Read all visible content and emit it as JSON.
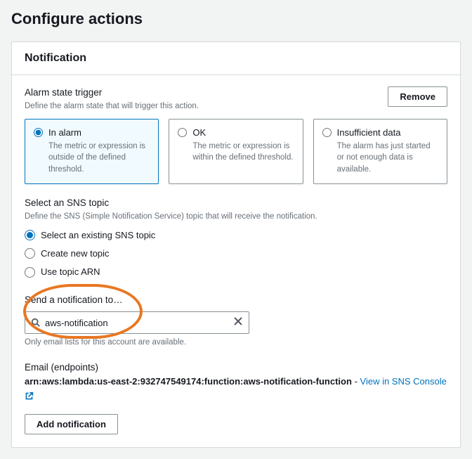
{
  "page": {
    "title": "Configure actions"
  },
  "panel": {
    "title": "Notification"
  },
  "alarm_trigger": {
    "label": "Alarm state trigger",
    "help": "Define the alarm state that will trigger this action.",
    "remove_btn": "Remove",
    "options": [
      {
        "title": "In alarm",
        "desc": "The metric or expression is outside of the defined threshold."
      },
      {
        "title": "OK",
        "desc": "The metric or expression is within the defined threshold."
      },
      {
        "title": "Insufficient data",
        "desc": "The alarm has just started or not enough data is available."
      }
    ]
  },
  "sns": {
    "label": "Select an SNS topic",
    "help": "Define the SNS (Simple Notification Service) topic that will receive the notification.",
    "options": {
      "existing": "Select an existing SNS topic",
      "create": "Create new topic",
      "arn": "Use topic ARN"
    }
  },
  "send_to": {
    "label": "Send a notification to…",
    "value": "aws-notification",
    "hint": "Only email lists for this account are available."
  },
  "endpoints": {
    "label": "Email (endpoints)",
    "arn": "arn:aws:lambda:us-east-2:932747549174:function:aws-notification-function",
    "link_text": "View in SNS Console"
  },
  "add_btn": "Add notification"
}
